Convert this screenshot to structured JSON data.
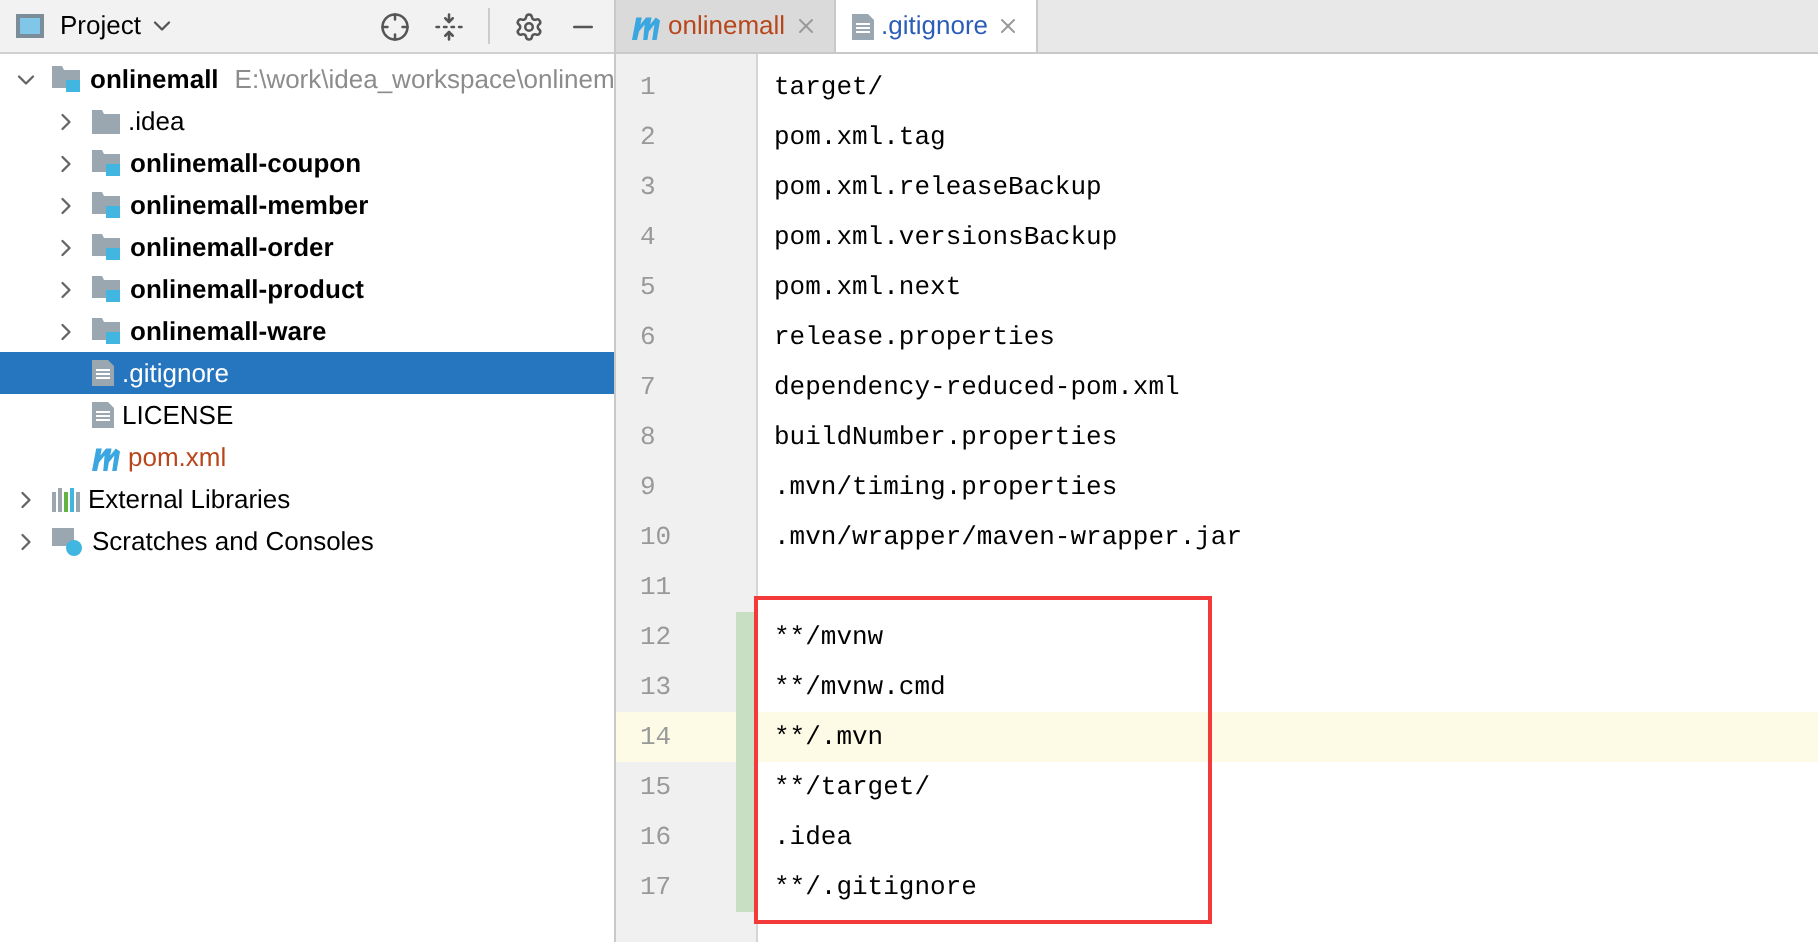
{
  "project_panel": {
    "title": "Project",
    "tree": [
      {
        "name": "onlinemall",
        "kind": "module",
        "hint": "E:\\work\\idea_workspace\\onlinem",
        "bold": true,
        "expanded": true,
        "selected": false,
        "children": [
          {
            "name": ".idea",
            "kind": "folder",
            "bold": false,
            "expanded": false,
            "selected": false
          },
          {
            "name": "onlinemall-coupon",
            "kind": "module",
            "bold": true,
            "expanded": false,
            "selected": false
          },
          {
            "name": "onlinemall-member",
            "kind": "module",
            "bold": true,
            "expanded": false,
            "selected": false
          },
          {
            "name": "onlinemall-order",
            "kind": "module",
            "bold": true,
            "expanded": false,
            "selected": false
          },
          {
            "name": "onlinemall-product",
            "kind": "module",
            "bold": true,
            "expanded": false,
            "selected": false
          },
          {
            "name": "onlinemall-ware",
            "kind": "module",
            "bold": true,
            "expanded": false,
            "selected": false
          },
          {
            "name": ".gitignore",
            "kind": "file",
            "bold": false,
            "selected": true
          },
          {
            "name": "LICENSE",
            "kind": "file",
            "bold": false,
            "selected": false
          },
          {
            "name": "pom.xml",
            "kind": "maven",
            "bold": false,
            "selected": false,
            "color": "#b8461b"
          }
        ]
      },
      {
        "name": "External Libraries",
        "kind": "library",
        "bold": false,
        "expanded": false,
        "selected": false
      },
      {
        "name": "Scratches and Consoles",
        "kind": "scratches",
        "bold": false,
        "expanded": false,
        "selected": false
      }
    ]
  },
  "editor": {
    "tabs": [
      {
        "label": "onlinemall",
        "kind": "maven",
        "selected": false
      },
      {
        "label": ".gitignore",
        "kind": "file",
        "selected": true
      }
    ],
    "lines": [
      {
        "number": "1",
        "text": "target/",
        "modified": false,
        "current": false,
        "boxed": false
      },
      {
        "number": "2",
        "text": "pom.xml.tag",
        "modified": false,
        "current": false,
        "boxed": false
      },
      {
        "number": "3",
        "text": "pom.xml.releaseBackup",
        "modified": false,
        "current": false,
        "boxed": false
      },
      {
        "number": "4",
        "text": "pom.xml.versionsBackup",
        "modified": false,
        "current": false,
        "boxed": false
      },
      {
        "number": "5",
        "text": "pom.xml.next",
        "modified": false,
        "current": false,
        "boxed": false
      },
      {
        "number": "6",
        "text": "release.properties",
        "modified": false,
        "current": false,
        "boxed": false
      },
      {
        "number": "7",
        "text": "dependency-reduced-pom.xml",
        "modified": false,
        "current": false,
        "boxed": false
      },
      {
        "number": "8",
        "text": "buildNumber.properties",
        "modified": false,
        "current": false,
        "boxed": false
      },
      {
        "number": "9",
        "text": ".mvn/timing.properties",
        "modified": false,
        "current": false,
        "boxed": false
      },
      {
        "number": "10",
        "text": ".mvn/wrapper/maven-wrapper.jar",
        "modified": false,
        "current": false,
        "boxed": false
      },
      {
        "number": "11",
        "modified": false,
        "current": false,
        "boxed": false
      },
      {
        "number": "12",
        "text": "**/mvnw",
        "modified": true,
        "current": false,
        "boxed": true
      },
      {
        "number": "13",
        "text": "**/mvnw.cmd",
        "modified": true,
        "current": false,
        "boxed": true
      },
      {
        "number": "14",
        "text": "**/.mvn",
        "modified": true,
        "current": true,
        "boxed": true
      },
      {
        "number": "15",
        "text": "**/target/",
        "modified": true,
        "current": false,
        "boxed": true
      },
      {
        "number": "16",
        "text": ".idea",
        "modified": true,
        "current": false,
        "boxed": true
      },
      {
        "number": "17",
        "text": "**/.gitignore",
        "modified": true,
        "current": false,
        "boxed": true
      }
    ]
  }
}
